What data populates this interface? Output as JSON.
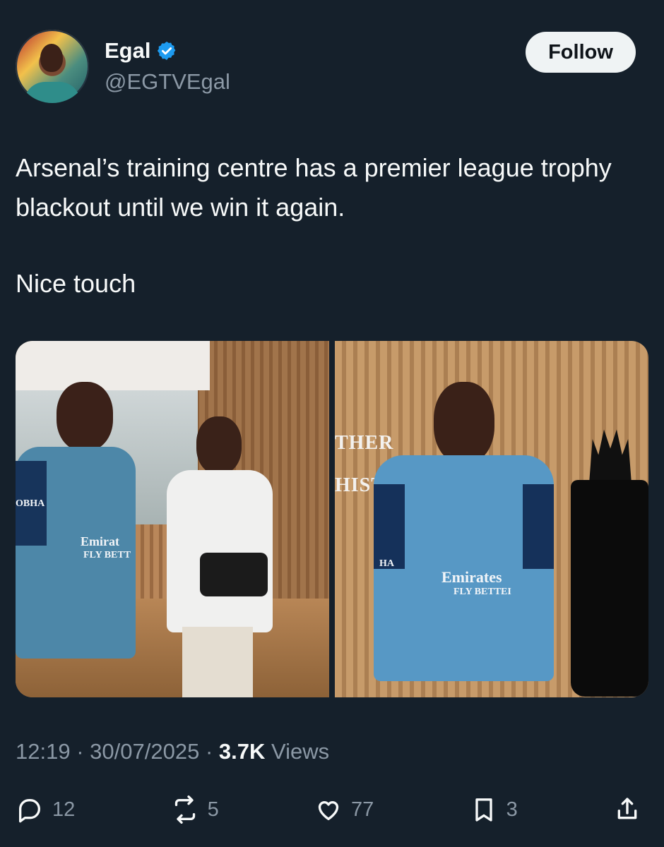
{
  "tweet": {
    "author": {
      "name": "Egal",
      "handle": "@EGTVEgal",
      "avatar": "profile-avatar",
      "verified": true
    },
    "follow_label": "Follow",
    "text": {
      "line1": "Arsenal’s training centre has a premier league trophy blackout until we win it again.",
      "line2": "Nice touch"
    },
    "media": {
      "left_image": "training-photo",
      "right_image": "trophy-photo",
      "left_sponsor_lines": [
        "Emirat",
        "FLY BETT",
        "OBHA"
      ],
      "right_sponsor_lines": [
        "Emirates",
        "FLY BETTEI",
        "HA"
      ],
      "wall_text": [
        "THER",
        "HISTORY"
      ]
    },
    "meta": {
      "time": "12:19",
      "separator": "·",
      "date": "30/07/2025",
      "views_count": "3.7K",
      "views_label": "Views"
    },
    "actions": {
      "replies": "12",
      "reposts": "5",
      "likes": "77",
      "bookmarks": "3",
      "icons": [
        "reply-icon",
        "repost-icon",
        "like-icon",
        "bookmark-icon",
        "share-icon"
      ]
    },
    "colors": {
      "background": "#15202b",
      "primary_text": "#f7f9f9",
      "secondary_text": "#8b98a5",
      "verified": "#1d9bf0",
      "button_bg": "#eff3f4"
    }
  }
}
